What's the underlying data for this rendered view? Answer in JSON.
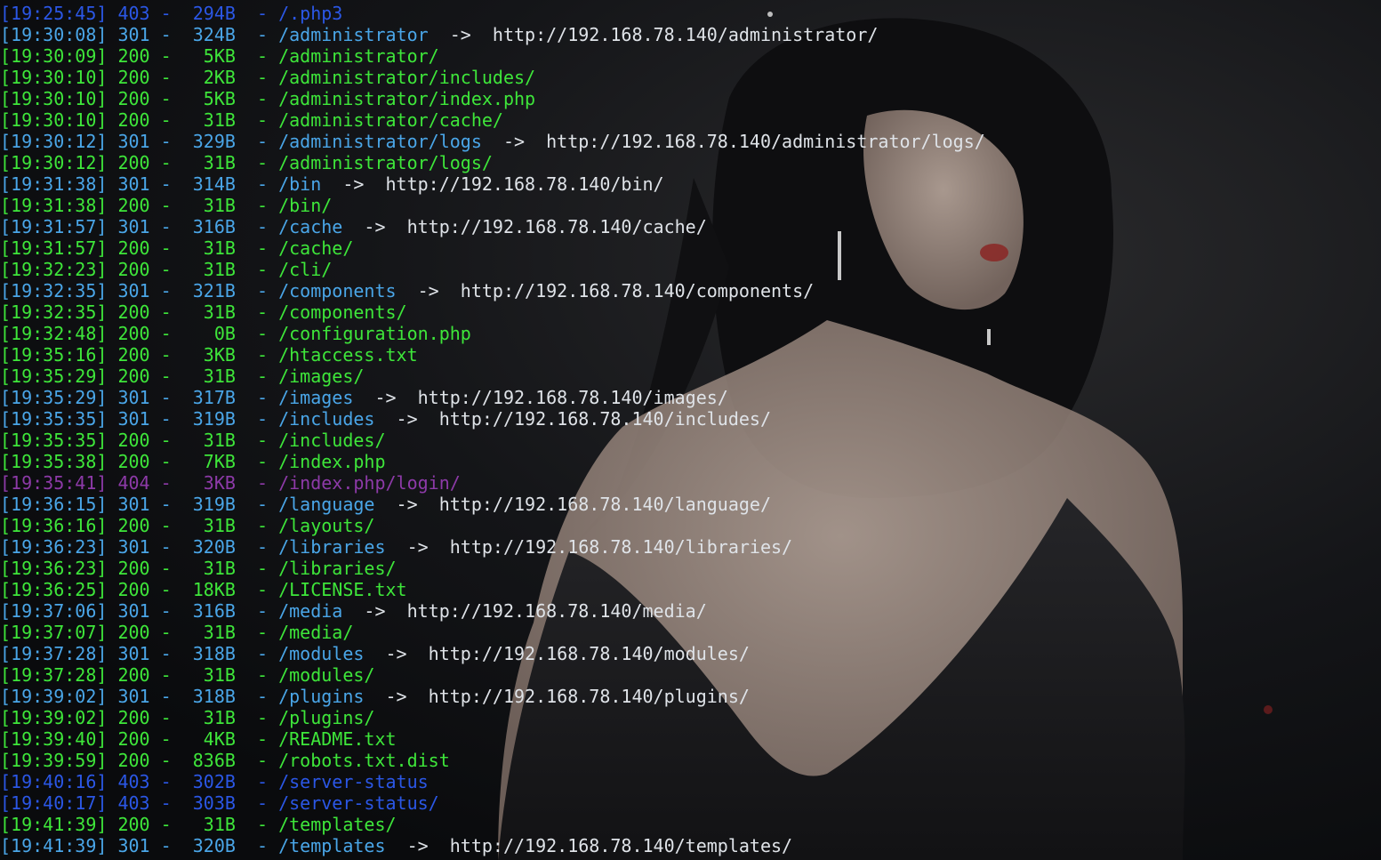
{
  "terminal": {
    "colors": {
      "ok": "#3ee63a",
      "redirect": "#4aa6e8",
      "forbidden": "#2b57e6",
      "not_found": "#8d3aa8",
      "url": "#dfe3e8"
    },
    "lines": [
      {
        "time": "[19:25:45]",
        "code": "403",
        "size": "294B",
        "path": "/.php3",
        "redirect": ""
      },
      {
        "time": "[19:30:08]",
        "code": "301",
        "size": "324B",
        "path": "/administrator",
        "redirect": "http://192.168.78.140/administrator/"
      },
      {
        "time": "[19:30:09]",
        "code": "200",
        "size": "5KB",
        "path": "/administrator/",
        "redirect": ""
      },
      {
        "time": "[19:30:10]",
        "code": "200",
        "size": "2KB",
        "path": "/administrator/includes/",
        "redirect": ""
      },
      {
        "time": "[19:30:10]",
        "code": "200",
        "size": "5KB",
        "path": "/administrator/index.php",
        "redirect": ""
      },
      {
        "time": "[19:30:10]",
        "code": "200",
        "size": "31B",
        "path": "/administrator/cache/",
        "redirect": ""
      },
      {
        "time": "[19:30:12]",
        "code": "301",
        "size": "329B",
        "path": "/administrator/logs",
        "redirect": "http://192.168.78.140/administrator/logs/"
      },
      {
        "time": "[19:30:12]",
        "code": "200",
        "size": "31B",
        "path": "/administrator/logs/",
        "redirect": ""
      },
      {
        "time": "[19:31:38]",
        "code": "301",
        "size": "314B",
        "path": "/bin",
        "redirect": "http://192.168.78.140/bin/"
      },
      {
        "time": "[19:31:38]",
        "code": "200",
        "size": "31B",
        "path": "/bin/",
        "redirect": ""
      },
      {
        "time": "[19:31:57]",
        "code": "301",
        "size": "316B",
        "path": "/cache",
        "redirect": "http://192.168.78.140/cache/"
      },
      {
        "time": "[19:31:57]",
        "code": "200",
        "size": "31B",
        "path": "/cache/",
        "redirect": ""
      },
      {
        "time": "[19:32:23]",
        "code": "200",
        "size": "31B",
        "path": "/cli/",
        "redirect": ""
      },
      {
        "time": "[19:32:35]",
        "code": "301",
        "size": "321B",
        "path": "/components",
        "redirect": "http://192.168.78.140/components/"
      },
      {
        "time": "[19:32:35]",
        "code": "200",
        "size": "31B",
        "path": "/components/",
        "redirect": ""
      },
      {
        "time": "[19:32:48]",
        "code": "200",
        "size": "0B",
        "path": "/configuration.php",
        "redirect": ""
      },
      {
        "time": "[19:35:16]",
        "code": "200",
        "size": "3KB",
        "path": "/htaccess.txt",
        "redirect": ""
      },
      {
        "time": "[19:35:29]",
        "code": "200",
        "size": "31B",
        "path": "/images/",
        "redirect": ""
      },
      {
        "time": "[19:35:29]",
        "code": "301",
        "size": "317B",
        "path": "/images",
        "redirect": "http://192.168.78.140/images/"
      },
      {
        "time": "[19:35:35]",
        "code": "301",
        "size": "319B",
        "path": "/includes",
        "redirect": "http://192.168.78.140/includes/"
      },
      {
        "time": "[19:35:35]",
        "code": "200",
        "size": "31B",
        "path": "/includes/",
        "redirect": ""
      },
      {
        "time": "[19:35:38]",
        "code": "200",
        "size": "7KB",
        "path": "/index.php",
        "redirect": ""
      },
      {
        "time": "[19:35:41]",
        "code": "404",
        "size": "3KB",
        "path": "/index.php/login/",
        "redirect": ""
      },
      {
        "time": "[19:36:15]",
        "code": "301",
        "size": "319B",
        "path": "/language",
        "redirect": "http://192.168.78.140/language/"
      },
      {
        "time": "[19:36:16]",
        "code": "200",
        "size": "31B",
        "path": "/layouts/",
        "redirect": ""
      },
      {
        "time": "[19:36:23]",
        "code": "301",
        "size": "320B",
        "path": "/libraries",
        "redirect": "http://192.168.78.140/libraries/"
      },
      {
        "time": "[19:36:23]",
        "code": "200",
        "size": "31B",
        "path": "/libraries/",
        "redirect": ""
      },
      {
        "time": "[19:36:25]",
        "code": "200",
        "size": "18KB",
        "path": "/LICENSE.txt",
        "redirect": ""
      },
      {
        "time": "[19:37:06]",
        "code": "301",
        "size": "316B",
        "path": "/media",
        "redirect": "http://192.168.78.140/media/"
      },
      {
        "time": "[19:37:07]",
        "code": "200",
        "size": "31B",
        "path": "/media/",
        "redirect": ""
      },
      {
        "time": "[19:37:28]",
        "code": "301",
        "size": "318B",
        "path": "/modules",
        "redirect": "http://192.168.78.140/modules/"
      },
      {
        "time": "[19:37:28]",
        "code": "200",
        "size": "31B",
        "path": "/modules/",
        "redirect": ""
      },
      {
        "time": "[19:39:02]",
        "code": "301",
        "size": "318B",
        "path": "/plugins",
        "redirect": "http://192.168.78.140/plugins/"
      },
      {
        "time": "[19:39:02]",
        "code": "200",
        "size": "31B",
        "path": "/plugins/",
        "redirect": ""
      },
      {
        "time": "[19:39:40]",
        "code": "200",
        "size": "4KB",
        "path": "/README.txt",
        "redirect": ""
      },
      {
        "time": "[19:39:59]",
        "code": "200",
        "size": "836B",
        "path": "/robots.txt.dist",
        "redirect": ""
      },
      {
        "time": "[19:40:16]",
        "code": "403",
        "size": "302B",
        "path": "/server-status",
        "redirect": ""
      },
      {
        "time": "[19:40:17]",
        "code": "403",
        "size": "303B",
        "path": "/server-status/",
        "redirect": ""
      },
      {
        "time": "[19:41:39]",
        "code": "200",
        "size": "31B",
        "path": "/templates/",
        "redirect": ""
      },
      {
        "time": "[19:41:39]",
        "code": "301",
        "size": "320B",
        "path": "/templates",
        "redirect": "http://192.168.78.140/templates/"
      }
    ]
  }
}
